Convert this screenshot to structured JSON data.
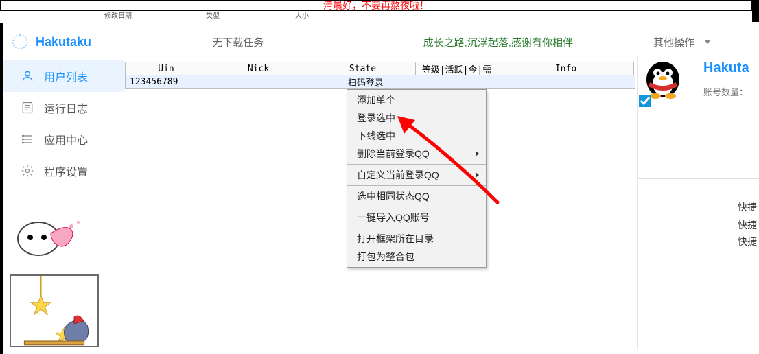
{
  "banner": {
    "text": "清晨好，不要再熬夜啦！"
  },
  "truncated_cols": {
    "c1": "修改日期",
    "c2": "类型",
    "c3": "大小"
  },
  "brand": {
    "name": "Hakutaku"
  },
  "header": {
    "no_download": "无下载任务",
    "motto": "成长之路,沉浮起落,感谢有你相伴",
    "other_ops": "其他操作"
  },
  "sidebar": {
    "items": [
      {
        "label": "用户列表"
      },
      {
        "label": "运行日志"
      },
      {
        "label": "应用中心"
      },
      {
        "label": "程序设置"
      }
    ]
  },
  "table": {
    "headers": {
      "uin": "Uin",
      "nick": "Nick",
      "state": "State",
      "level": "等级|活跃|今|需",
      "info": "Info"
    },
    "rows": [
      {
        "uin": "123456789",
        "nick": "",
        "state": "扫码登录",
        "level": "",
        "info": ""
      }
    ]
  },
  "context_menu": {
    "groups": [
      [
        {
          "label": "添加单个"
        },
        {
          "label": "登录选中"
        },
        {
          "label": "下线选中"
        },
        {
          "label": "删除当前登录QQ",
          "submenu": true
        }
      ],
      [
        {
          "label": "自定义当前登录QQ",
          "submenu": true
        }
      ],
      [
        {
          "label": "选中相同状态QQ"
        }
      ],
      [
        {
          "label": "一键导入QQ账号"
        }
      ],
      [
        {
          "label": "打开框架所在目录"
        },
        {
          "label": "打包为整合包"
        }
      ]
    ]
  },
  "right_panel": {
    "title": "Hakuta",
    "account_count_label": "账号数量：",
    "shortcuts": [
      "快捷",
      "快捷",
      "快捷"
    ]
  }
}
